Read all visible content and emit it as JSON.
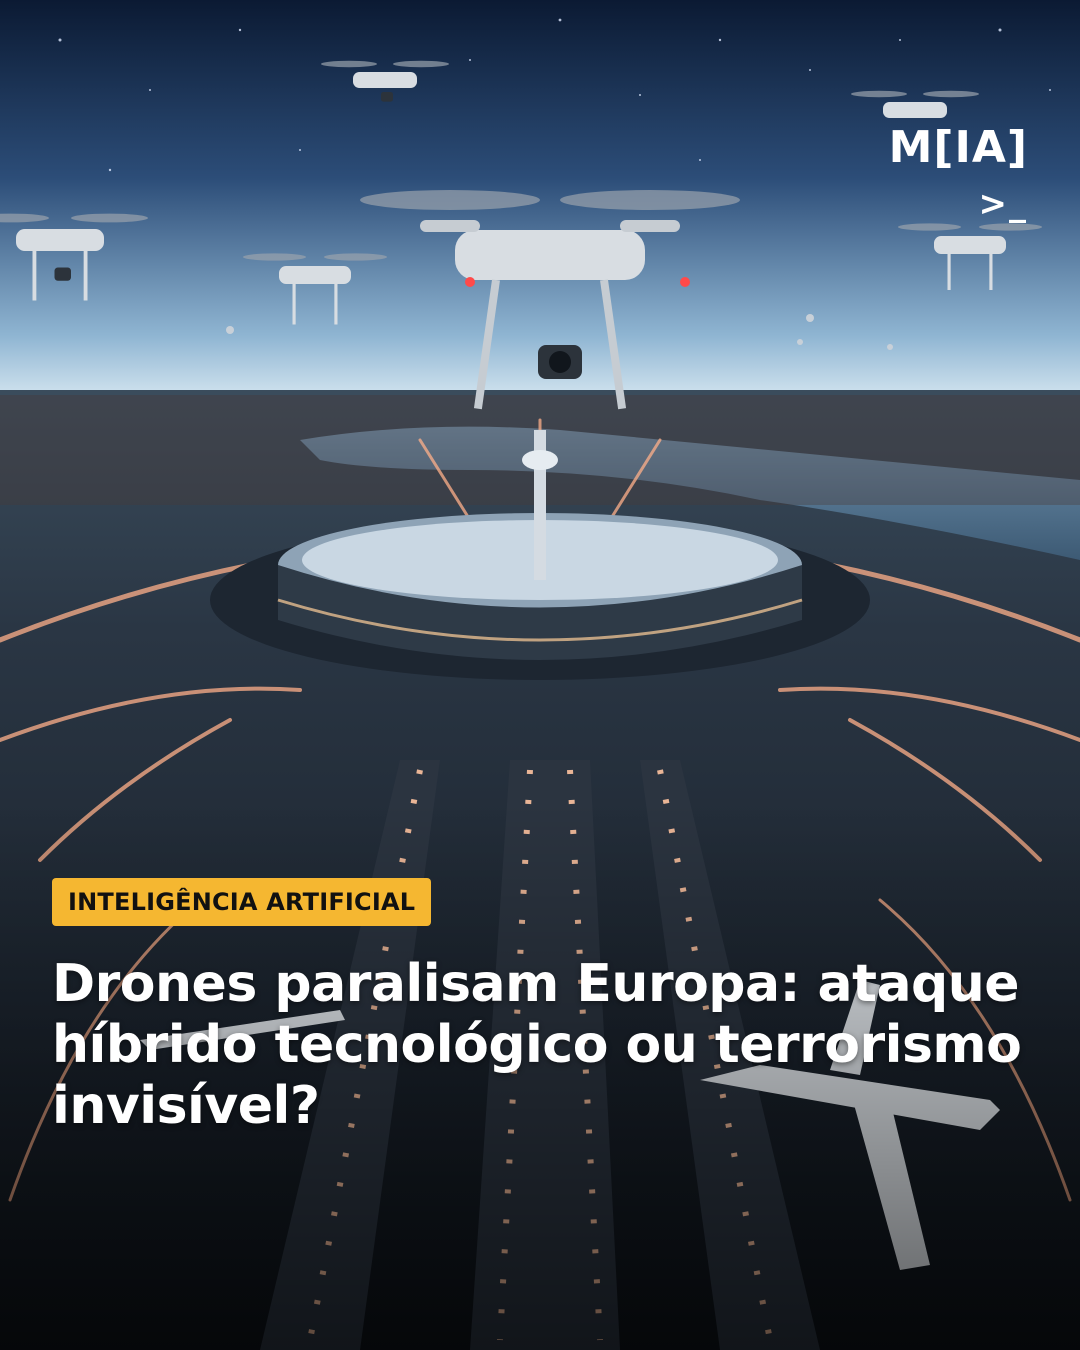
{
  "brand": {
    "logo_text": "M[IA]",
    "logo_prompt": ">_"
  },
  "category_badge": {
    "label": "INTELIGÊNCIA ARTIFICIAL",
    "color": "#f5b731"
  },
  "headline": {
    "text": "Drones paralisam Europa: ataque híbrido tecnológico ou terrorismo invisível?"
  },
  "colors": {
    "sky_top": "#0b1a33",
    "horizon": "#a9c9e0",
    "runway_lights": "#ffb08a",
    "text": "#ffffff"
  }
}
